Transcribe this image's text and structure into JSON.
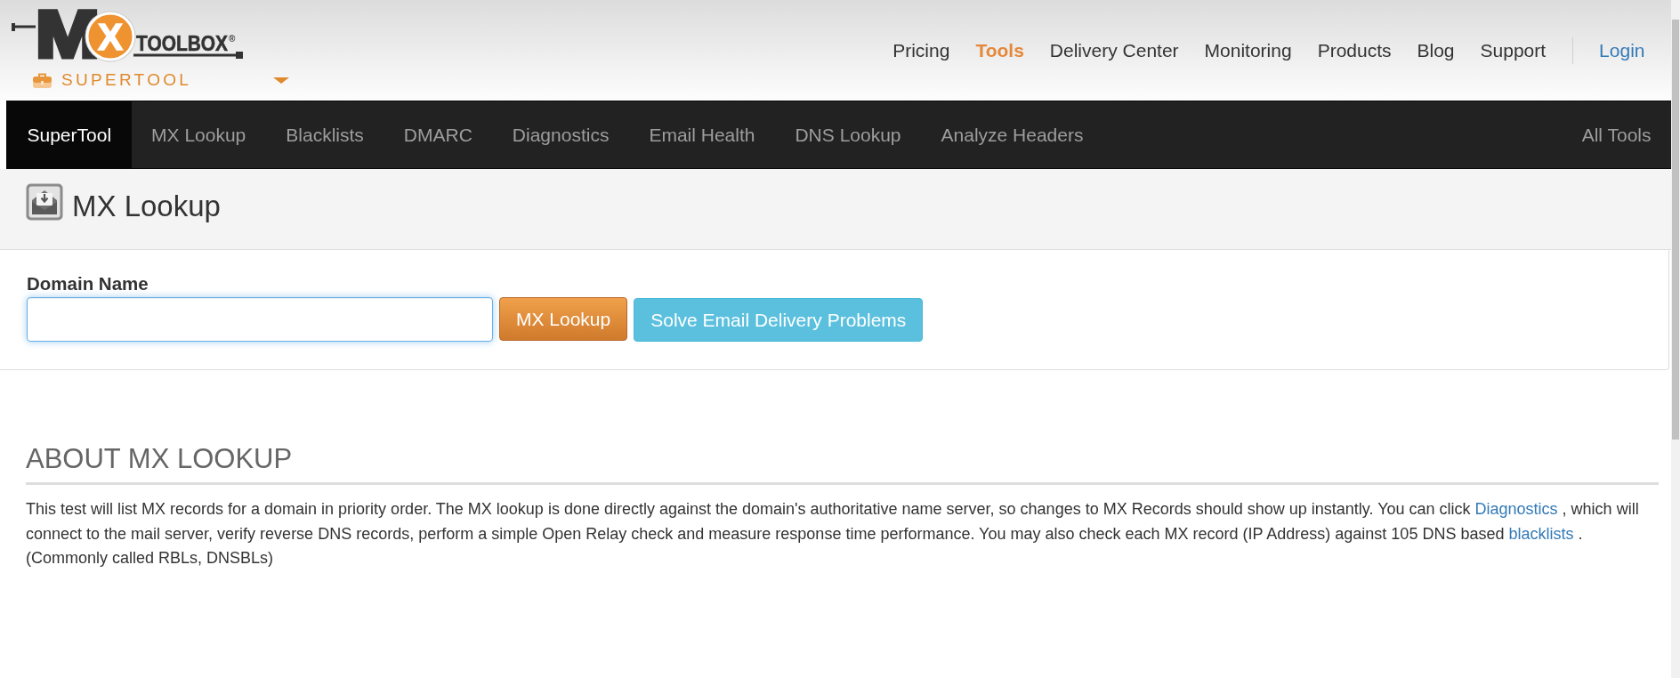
{
  "logo": {
    "m": "M",
    "x": "X",
    "wordmark": "TOOLBOX",
    "mark": "®"
  },
  "tool_switcher": {
    "label": "SUPERTOOL"
  },
  "top_nav": {
    "items": [
      {
        "label": "Pricing",
        "selected": false
      },
      {
        "label": "Tools",
        "selected": true
      },
      {
        "label": "Delivery Center",
        "selected": false
      },
      {
        "label": "Monitoring",
        "selected": false
      },
      {
        "label": "Products",
        "selected": false
      },
      {
        "label": "Blog",
        "selected": false
      },
      {
        "label": "Support",
        "selected": false
      }
    ],
    "login": "Login"
  },
  "tool_nav": {
    "items": [
      {
        "label": "SuperTool",
        "selected": true
      },
      {
        "label": "MX Lookup",
        "selected": false
      },
      {
        "label": "Blacklists",
        "selected": false
      },
      {
        "label": "DMARC",
        "selected": false
      },
      {
        "label": "Diagnostics",
        "selected": false
      },
      {
        "label": "Email Health",
        "selected": false
      },
      {
        "label": "DNS Lookup",
        "selected": false
      },
      {
        "label": "Analyze Headers",
        "selected": false
      }
    ],
    "all_tools": "All Tools"
  },
  "page_title": "MX Lookup",
  "form": {
    "label": "Domain Name",
    "domain_field": {
      "focused": true
    },
    "buttons": [
      {
        "label": "MX Lookup",
        "kind": "primary"
      },
      {
        "label": "Solve Email Delivery Problems",
        "kind": "info"
      }
    ]
  },
  "about": {
    "title": "ABOUT MX LOOKUP",
    "paragraph": [
      {
        "kind": "text",
        "text": "This test will list MX records for a domain in priority order. The MX lookup is done directly against the domain's authoritative name server, so changes to MX Records should show up instantly. You can click "
      },
      {
        "kind": "link",
        "text": "Diagnostics"
      },
      {
        "kind": "text",
        "text": " , which will connect to the mail server, verify reverse DNS records, perform a simple Open Relay check and measure response time performance. You may also check each MX record (IP Address) against 105 DNS based "
      },
      {
        "kind": "link",
        "text": "blacklists"
      },
      {
        "kind": "text",
        "text": " . (Commonly called RBLs, DNSBLs)"
      }
    ]
  }
}
